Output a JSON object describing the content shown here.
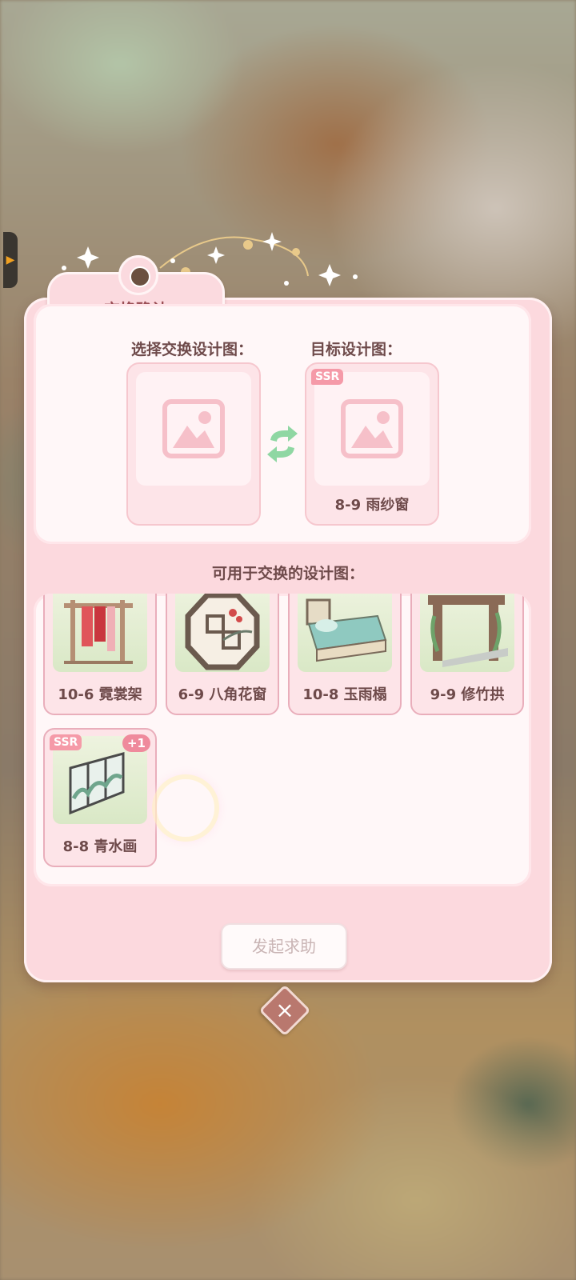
{
  "dialog": {
    "title": "交换确认",
    "select_label": "选择交换设计图：",
    "target_label": "目标设计图：",
    "target": {
      "rarity": "SSR",
      "name": "8-9 雨纱窗"
    },
    "available_label": "可用于交换的设计图：",
    "available": [
      {
        "name": "10-6 霓裳架",
        "art": "clothes-rack"
      },
      {
        "name": "6-9 八角花窗",
        "art": "octagon-window"
      },
      {
        "name": "10-8 玉雨榻",
        "art": "daybed"
      },
      {
        "name": "9-9 修竹拱",
        "art": "bamboo-arch"
      },
      {
        "name": "8-8 青水画",
        "art": "landscape-screen",
        "rarity": "SSR",
        "count": "+1"
      }
    ],
    "help_button": "发起求助",
    "close_icon": "×"
  },
  "colors": {
    "panel_pink": "#fcd9de",
    "title_text": "#9b4e55",
    "body_text": "#6e4a4a",
    "ssr_badge": "#f59aa8",
    "swap_arrows": "#8fd7a3"
  }
}
